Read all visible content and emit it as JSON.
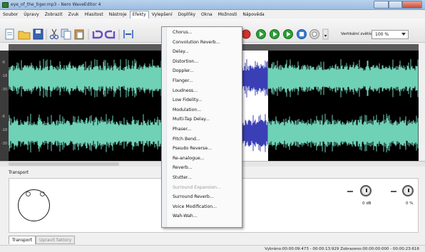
{
  "window": {
    "title": "eye_of_the_tiger.mp3 - Nero WaveEditor 4"
  },
  "menu": [
    {
      "label": "Soubor"
    },
    {
      "label": "Úpravy"
    },
    {
      "label": "Zobrazit"
    },
    {
      "label": "Zvuk"
    },
    {
      "label": "Hlasitost"
    },
    {
      "label": "Nástroje"
    },
    {
      "label": "Efekty"
    },
    {
      "label": "Vylepšení"
    },
    {
      "label": "Doplňky"
    },
    {
      "label": "Okna"
    },
    {
      "label": "Možnosti"
    },
    {
      "label": "Nápověda"
    }
  ],
  "effects_menu": [
    {
      "label": "Chorus...",
      "enabled": true
    },
    {
      "label": "Convolution Reverb...",
      "enabled": true
    },
    {
      "label": "Delay...",
      "enabled": true
    },
    {
      "label": "Distortion...",
      "enabled": true
    },
    {
      "label": "Doppler...",
      "enabled": true
    },
    {
      "label": "Flanger...",
      "enabled": true
    },
    {
      "label": "Loudness...",
      "enabled": true
    },
    {
      "label": "Low Fidelity...",
      "enabled": true
    },
    {
      "label": "Modulation...",
      "enabled": true
    },
    {
      "label": "Multi-Tap Delay...",
      "enabled": true
    },
    {
      "label": "Phaser...",
      "enabled": true
    },
    {
      "label": "Pitch Bend...",
      "enabled": true
    },
    {
      "label": "Pseudo Reverse...",
      "enabled": true
    },
    {
      "label": "Re-analogue...",
      "enabled": true
    },
    {
      "label": "Reverb...",
      "enabled": true
    },
    {
      "label": "Stutter...",
      "enabled": true
    },
    {
      "label": "Surround Expansion...",
      "enabled": false
    },
    {
      "label": "Surround Reverb...",
      "enabled": true
    },
    {
      "label": "Voice Modification...",
      "enabled": true
    },
    {
      "label": "Wah-Wah...",
      "enabled": true
    }
  ],
  "toolbar": {
    "zoom_label": "Vertikální zvětšení:",
    "zoom_value": "100 %",
    "icons": [
      "new-file-icon",
      "open-file-icon",
      "save-icon",
      "cut-icon",
      "copy-icon",
      "paste-icon",
      "undo-icon",
      "redo-icon",
      "fit-icon",
      "record-icon",
      "play-icon",
      "play-loop-icon",
      "play-selection-icon",
      "stop-icon",
      "pause-icon",
      "menu-arrow-icon"
    ]
  },
  "db_scale": [
    "-6",
    "-18",
    "-30",
    "-6",
    "-18",
    "-30"
  ],
  "transport": {
    "section_label": "Transport",
    "knob1_label": "0 dB",
    "knob2_label": "0 %"
  },
  "tabs": [
    {
      "label": "Transport",
      "active": true
    },
    {
      "label": "Upravit faktory",
      "active": false
    }
  ],
  "status": {
    "text": "Vybráno:00:00:09:473 - 00:00:13:929  Zobrazeno:00:00:00:000 - 00:00:23:616"
  },
  "colors": {
    "waveform": "#6fd1b6",
    "selection_waveform": "#3a3fb5",
    "background": "#000000",
    "title_bar": "#a9c6e6"
  }
}
